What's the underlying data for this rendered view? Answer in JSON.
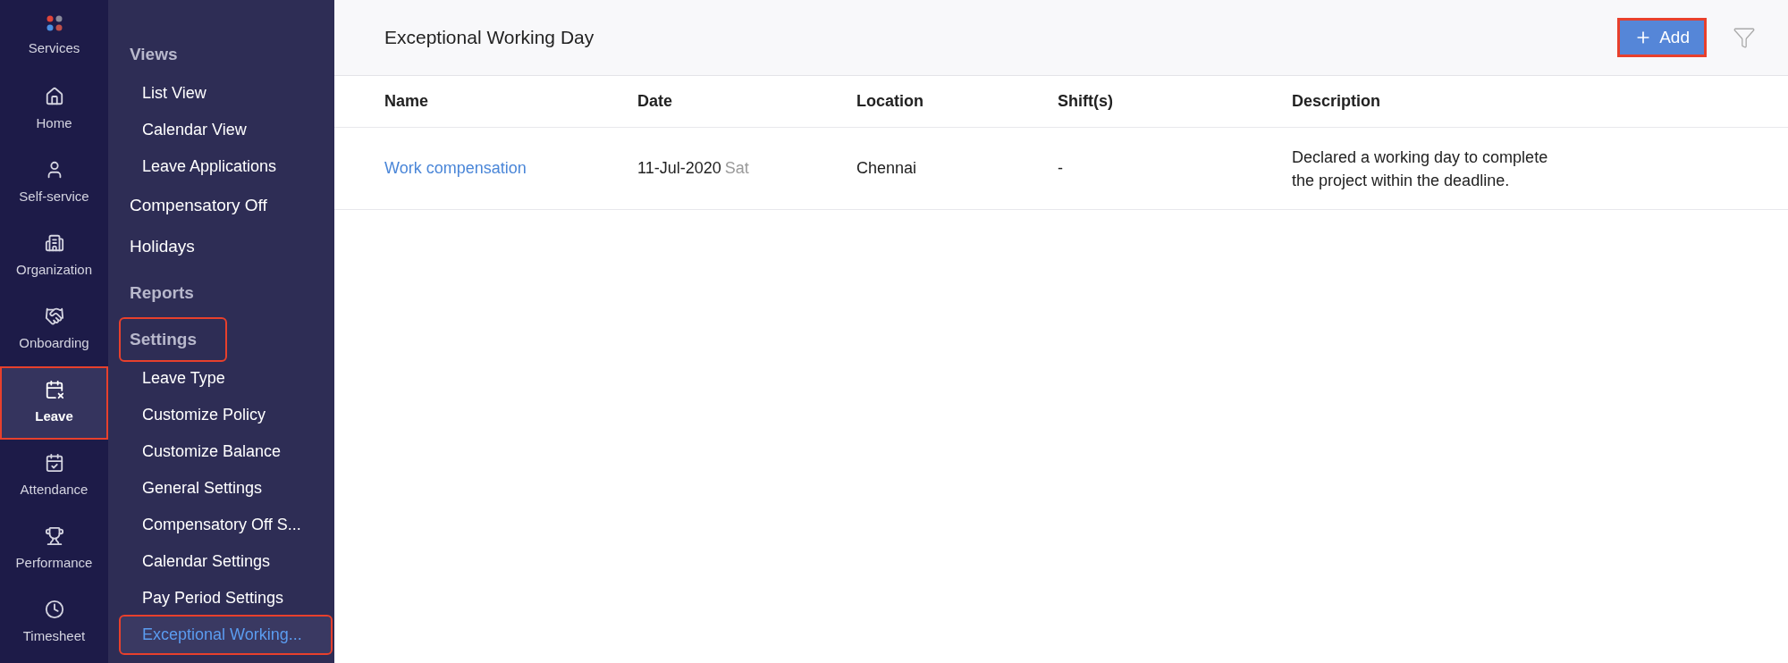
{
  "rail": {
    "items": [
      {
        "label": "Services",
        "kind": "services",
        "selected": false,
        "highlighted": false
      },
      {
        "label": "Home",
        "kind": "home",
        "selected": false,
        "highlighted": false
      },
      {
        "label": "Self-service",
        "kind": "user",
        "selected": false,
        "highlighted": false
      },
      {
        "label": "Organization",
        "kind": "building",
        "selected": false,
        "highlighted": false
      },
      {
        "label": "Onboarding",
        "kind": "handshake",
        "selected": false,
        "highlighted": false
      },
      {
        "label": "Leave",
        "kind": "leave",
        "selected": true,
        "highlighted": true
      },
      {
        "label": "Attendance",
        "kind": "attendance",
        "selected": false,
        "highlighted": false
      },
      {
        "label": "Performance",
        "kind": "performance",
        "selected": false,
        "highlighted": false
      },
      {
        "label": "Timesheet",
        "kind": "timesheet",
        "selected": false,
        "highlighted": false
      }
    ]
  },
  "submenu": {
    "items": [
      {
        "kind": "heading",
        "label": "Views",
        "selected": false,
        "highlighted": false
      },
      {
        "kind": "subitem",
        "label": "List View",
        "selected": false,
        "highlighted": false
      },
      {
        "kind": "subitem",
        "label": "Calendar View",
        "selected": false,
        "highlighted": false
      },
      {
        "kind": "subitem",
        "label": "Leave Applications",
        "selected": false,
        "highlighted": false
      },
      {
        "kind": "link",
        "label": "Compensatory Off",
        "selected": false,
        "highlighted": false
      },
      {
        "kind": "link",
        "label": "Holidays",
        "selected": false,
        "highlighted": false
      },
      {
        "kind": "heading",
        "label": "Reports",
        "selected": false,
        "highlighted": false
      },
      {
        "kind": "heading",
        "label": "Settings",
        "selected": false,
        "highlighted": true
      },
      {
        "kind": "subitem",
        "label": "Leave Type",
        "selected": false,
        "highlighted": false
      },
      {
        "kind": "subitem",
        "label": "Customize Policy",
        "selected": false,
        "highlighted": false
      },
      {
        "kind": "subitem",
        "label": "Customize Balance",
        "selected": false,
        "highlighted": false
      },
      {
        "kind": "subitem",
        "label": "General Settings",
        "selected": false,
        "highlighted": false
      },
      {
        "kind": "subitem",
        "label": "Compensatory Off S...",
        "selected": false,
        "highlighted": false
      },
      {
        "kind": "subitem",
        "label": "Calendar Settings",
        "selected": false,
        "highlighted": false
      },
      {
        "kind": "subitem",
        "label": "Pay Period Settings",
        "selected": false,
        "highlighted": false
      },
      {
        "kind": "subitem",
        "label": "Exceptional Working...",
        "selected": true,
        "highlighted": true
      }
    ]
  },
  "header": {
    "title": "Exceptional Working Day",
    "add_button": {
      "label": "Add",
      "highlighted": true
    }
  },
  "table": {
    "columns": [
      "Name",
      "Date",
      "Location",
      "Shift(s)",
      "Description"
    ],
    "rows": [
      {
        "name": "Work compensation",
        "date": "11-Jul-2020",
        "weekday": "Sat",
        "location": "Chennai",
        "shifts": "-",
        "description": "Declared a working day to complete the project within the deadline."
      }
    ]
  }
}
